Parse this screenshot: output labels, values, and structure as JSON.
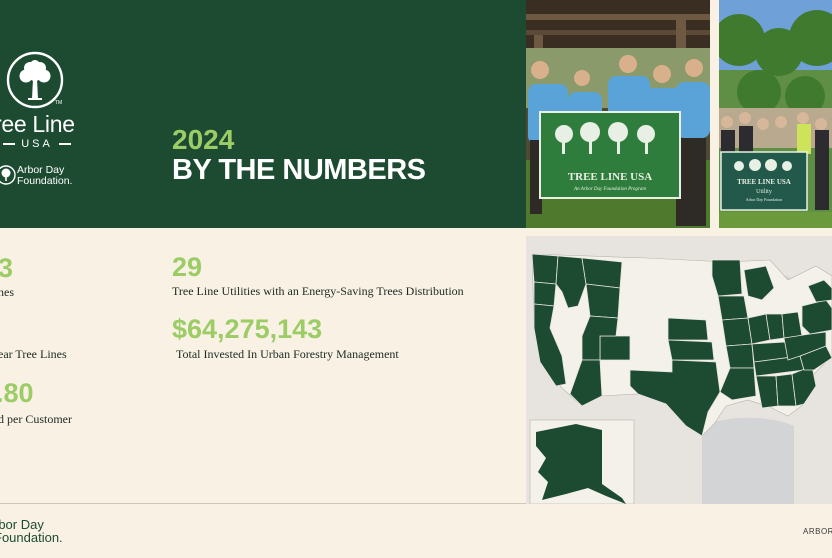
{
  "brand": {
    "logo_name": "ree Line",
    "logo_sub": "USA",
    "trademark": "TM",
    "partner": "Arbor Day\nFoundation."
  },
  "hero": {
    "year": "2024",
    "headline": "BY THE NUMBERS"
  },
  "stats_left": [
    {
      "value": "3",
      "label": "nes"
    },
    {
      "value": "",
      "label": "ear Tree Lines"
    },
    {
      "value": ".80",
      "label": "d per Customer"
    }
  ],
  "stats_right": [
    {
      "value": "29",
      "label": "Tree Line Utilities with an Energy-Saving Trees Distribution"
    },
    {
      "value": "$64,275,143",
      "label": "Total Invested In Urban Forestry Management"
    }
  ],
  "banners": {
    "main_title": "TREE LINE USA",
    "main_sub": "An Arbor Day Foundation Program",
    "utility_title": "TREE LINE USA",
    "utility_line2": "Utility",
    "utility_line3": "Arbor Day Foundation"
  },
  "footer": {
    "logo": "rbor Day\nFoundation.",
    "right_text": "ARBOR"
  },
  "colors": {
    "forest_green": "#1d4b32",
    "lime_accent": "#9ccc65",
    "cream": "#f8f1e4"
  },
  "icons": [
    "tree-logo-icon",
    "arbor-day-tree-icon"
  ]
}
